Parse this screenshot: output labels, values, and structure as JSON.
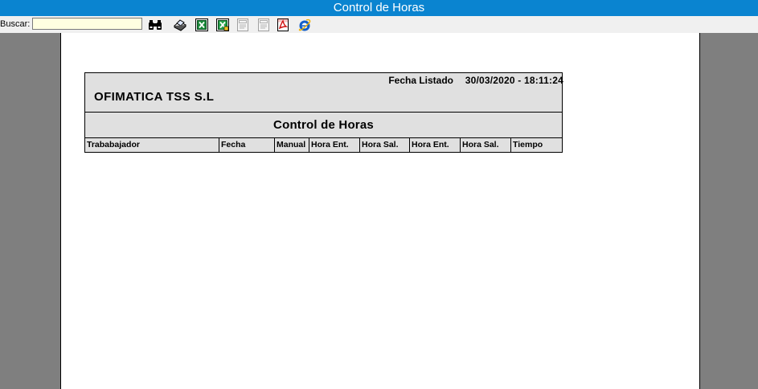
{
  "window": {
    "title": "Control de Horas"
  },
  "toolbar": {
    "search_label": "Buscar:",
    "search_value": "",
    "buttons": [
      {
        "icon": "binoculars-icon"
      },
      {
        "icon": "print-icon"
      },
      {
        "icon": "excel-icon"
      },
      {
        "icon": "excel-export-icon"
      },
      {
        "icon": "page-disabled-icon"
      },
      {
        "icon": "page-disabled-icon"
      },
      {
        "icon": "pdf-icon"
      },
      {
        "icon": "internet-explorer-icon"
      }
    ]
  },
  "report": {
    "fecha_label": "Fecha Listado",
    "fecha_value": "30/03/2020 - 18:11:24",
    "company": "OFIMATICA TSS S.L",
    "title": "Control de Horas",
    "columns": [
      "Trababajador",
      "Fecha",
      "Manual",
      "Hora Ent.",
      "Hora Sal.",
      "Hora Ent.",
      "Hora Sal.",
      "Tiempo"
    ]
  }
}
